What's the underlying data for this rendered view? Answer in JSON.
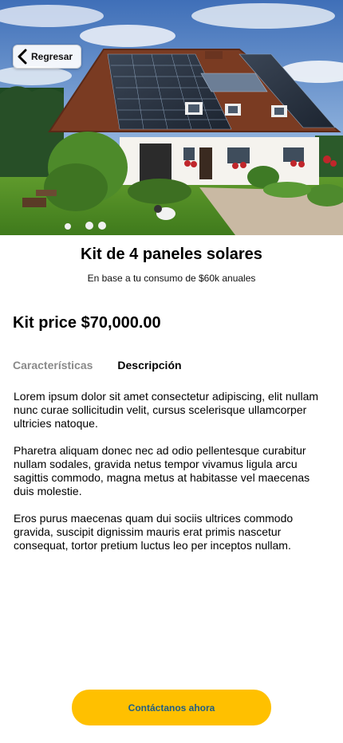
{
  "header": {
    "back_label": "Regresar"
  },
  "product": {
    "title": "Kit de 4 paneles solares",
    "subtitle": "En base a tu consumo de $60k anuales",
    "price": "Kit price $70,000.00"
  },
  "tabs": [
    {
      "label": "Características",
      "active": false
    },
    {
      "label": "Descripción",
      "active": true
    }
  ],
  "description": [
    "Lorem ipsum dolor sit amet consectetur adipiscing, elit nullam nunc curae sollicitudin velit, cursus scelerisque ullamcorper ultricies natoque.",
    "Pharetra aliquam donec nec ad odio pellentesque curabitur nullam sodales, gravida netus tempor vivamus ligula arcu sagittis commodo, magna metus at habitasse vel maecenas duis molestie.",
    "Eros purus maecenas quam dui sociis ultrices commodo gravida, suscipit dignissim mauris erat primis nascetur consequat, tortor pretium luctus leo per inceptos nullam."
  ],
  "cta": {
    "label": "Contáctanos ahora"
  },
  "colors": {
    "accent": "#FFC000",
    "cta_text": "#1f5e85",
    "inactive_tab": "#8a8a8a"
  }
}
